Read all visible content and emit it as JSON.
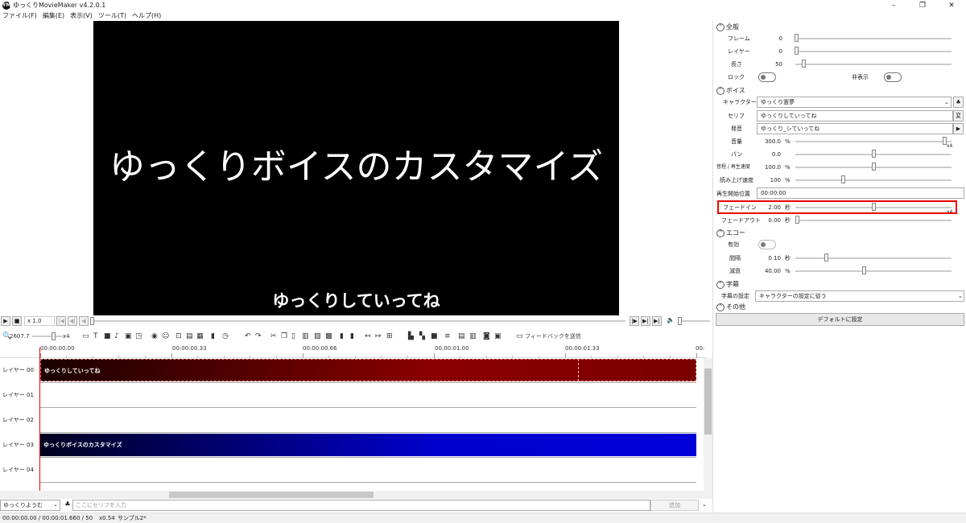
{
  "window": {
    "title": "ゆっくりMovieMaker v4.2.0.1",
    "icon_text": "YM",
    "controls": {
      "minimize": "–",
      "maximize": "❐",
      "close": "✕"
    }
  },
  "menu": [
    "ファイル(F)",
    "編集(E)",
    "表示(V)",
    "ツール(T)",
    "ヘルプ(H)"
  ],
  "preview": {
    "title_text": "ゆっくりボイスのカスタマイズ",
    "caption_text": "ゆっくりしていってね"
  },
  "playback": {
    "play": "▶",
    "stop": "■",
    "speed": "x 1.0",
    "frame_prev_start": "|◀",
    "frame_prev": "◀|",
    "frame_back": "◀",
    "frame_fwd": "|▶",
    "frame_next": "▶|",
    "frame_end": "▶|",
    "volume_icon": "🔈"
  },
  "toolbar": {
    "zoom_icon": "🔍",
    "zoom_value": "2607.7",
    "speed_label": "x4",
    "feedback_label": "フィードバックを送信"
  },
  "timeline": {
    "ticks": [
      "00:00:00.00",
      "00:00:00.33",
      "00:00:00.66",
      "00:00:01.00",
      "00:00:01.33",
      "00:"
    ],
    "layers": [
      {
        "label": "レイヤー 00",
        "clip": "ゆっくりしていってね"
      },
      {
        "label": "レイヤー 01",
        "clip": ""
      },
      {
        "label": "レイヤー 02",
        "clip": ""
      },
      {
        "label": "レイヤー 03",
        "clip": "ゆっくりボイスのカスタマイズ"
      },
      {
        "label": "レイヤー 04",
        "clip": ""
      }
    ]
  },
  "input_bar": {
    "voice": "ゆっくりようむ",
    "placeholder": "ここにセリフを入力",
    "add_label": "追加"
  },
  "status": {
    "time": "00:00:00.00 / 00:00:01.66",
    "frames": "0 / 50",
    "zoom": "x0.54",
    "project": "サンプル2*"
  },
  "panel": {
    "general": {
      "title": "全般",
      "frame_label": "フレーム",
      "frame_value": "0",
      "layer_label": "レイヤー",
      "layer_value": "0",
      "length_label": "長さ",
      "length_value": "50",
      "lock_label": "ロック",
      "hide_label": "非表示"
    },
    "voice": {
      "title": "ボイス",
      "character_label": "キャラクター",
      "character_value": "ゆっくり霊夢",
      "serif_label": "セリフ",
      "serif_value": "ゆっくりしていってね",
      "hatsuon_label": "発音",
      "hatsuon_value": "ゆっくり_シていってね",
      "change_btn": "変",
      "play_btn": "▶",
      "volume_label": "音量",
      "volume_value": "300.0",
      "volume_unit": "%",
      "volume_x": "x4",
      "pan_label": "パン",
      "pan_value": "0.0",
      "pitch_label": "音程 / 再生速度",
      "pitch_value": "100.0",
      "pitch_unit": "%",
      "read_label": "読み上げ速度",
      "read_value": "100",
      "read_unit": "%",
      "start_label": "再生開始位置",
      "start_value": "00:00:00",
      "fadein_label": "フェードイン",
      "fadein_value": "2.00",
      "fadein_unit": "秒",
      "fadein_x": "x4",
      "fadeout_label": "フェードアウト",
      "fadeout_value": "0.00",
      "fadeout_unit": "秒",
      "volume": 0.97,
      "pan": 0.5,
      "pitch": 0.5,
      "read": 0.3,
      "fadein": 0.5,
      "fadeout": 0.0
    },
    "echo": {
      "title": "エコー",
      "enable_label": "有効",
      "interval_label": "間隔",
      "interval_value": "0.10",
      "interval_unit": "秒",
      "decay_label": "減衰",
      "decay_value": "40.00",
      "decay_unit": "%",
      "interval": 0.1,
      "decay": 0.4
    },
    "subtitle": {
      "title": "字幕",
      "setting_label": "字幕の設定",
      "setting_value": "キャラクターの設定に従う"
    },
    "other": {
      "title": "その他",
      "default_button": "デフォルトに設定"
    }
  },
  "colors": {
    "clip_red_dark": "#1a0000",
    "clip_red": "#8b0000",
    "clip_blue_dark": "#000020",
    "clip_blue": "#0000cc",
    "highlight": "#e00000"
  }
}
